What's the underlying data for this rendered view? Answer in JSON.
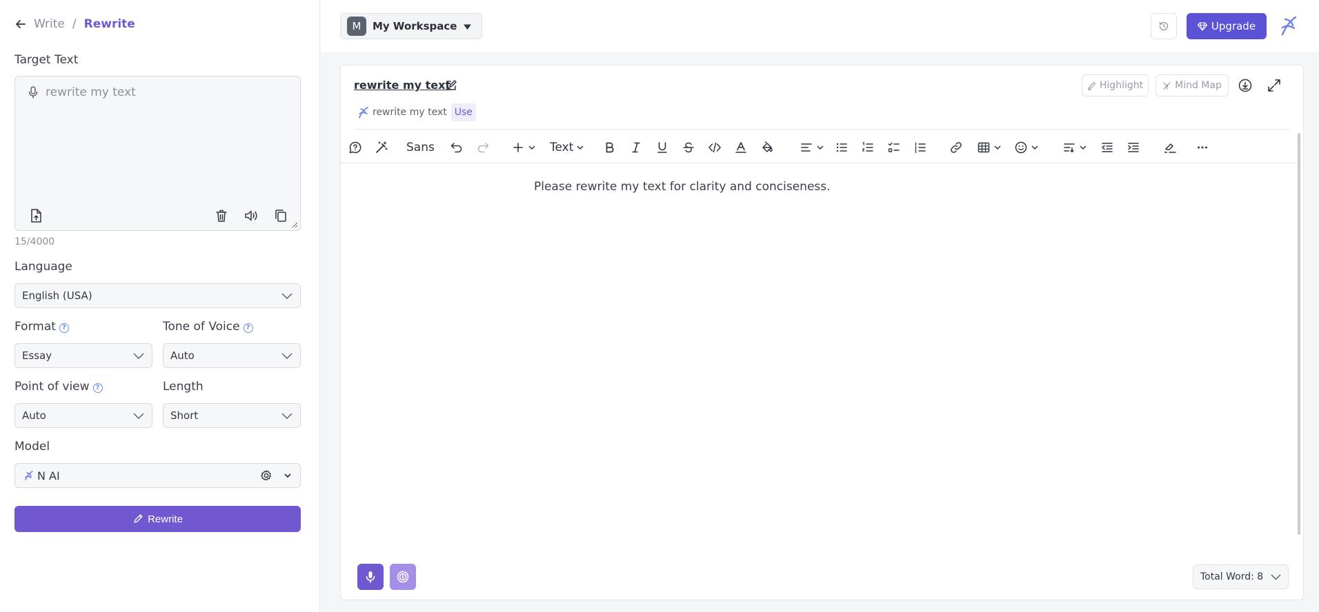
{
  "breadcrumb": {
    "parent": "Write",
    "separator": "/",
    "current": "Rewrite"
  },
  "target_text": {
    "label": "Target Text",
    "placeholder": "rewrite my text",
    "counter": "15/4000"
  },
  "language": {
    "label": "Language",
    "value": "English (USA)"
  },
  "format": {
    "label": "Format",
    "value": "Essay"
  },
  "tone": {
    "label": "Tone of Voice",
    "value": "Auto"
  },
  "point_of_view": {
    "label": "Point of view",
    "value": "Auto"
  },
  "length": {
    "label": "Length",
    "value": "Short"
  },
  "model": {
    "label": "Model",
    "value": "N AI"
  },
  "rewrite_button": "Rewrite",
  "topbar": {
    "workspace_initial": "M",
    "workspace_name": "My Workspace",
    "upgrade_label": "Upgrade"
  },
  "editor": {
    "doc_title": "rewrite my text",
    "highlight_label": "Highlight",
    "mind_map_label": "Mind Map",
    "suggestion_text": "rewrite my text",
    "use_label": "Use",
    "font_label": "Sans",
    "block_type_label": "Text",
    "content": "Please rewrite my text for clarity and conciseness.",
    "word_count": "Total Word: 8"
  },
  "colors": {
    "accent": "#7059d0",
    "upgrade": "#5b52d6",
    "rec_active": "#7059d0",
    "rec_secondary": "#a48ee6"
  }
}
